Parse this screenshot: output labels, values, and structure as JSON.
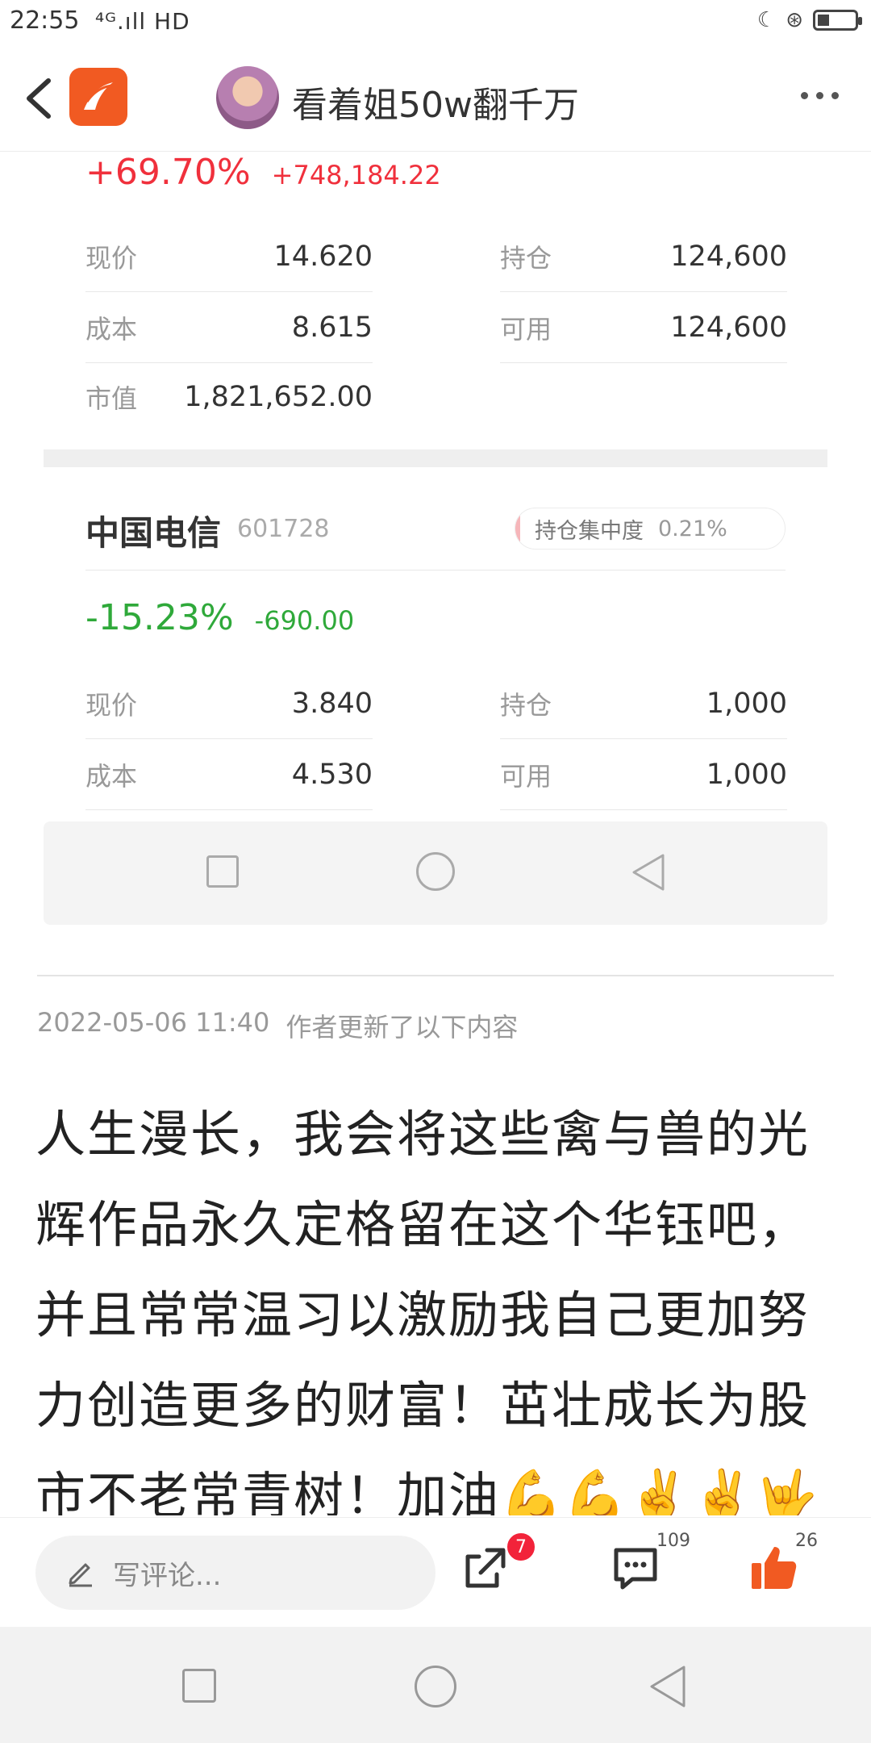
{
  "status": {
    "time": "22:55",
    "network": "⁴ᴳ.ıll HD"
  },
  "nav": {
    "title": "看着姐50w翻千万"
  },
  "stock1": {
    "pct": "+69.70%",
    "amount": "+748,184.22",
    "price_label": "现价",
    "price": "14.620",
    "holding_label": "持仓",
    "holding": "124,600",
    "cost_label": "成本",
    "cost": "8.615",
    "available_label": "可用",
    "available": "124,600",
    "mv_label": "市值",
    "mv": "1,821,652.00"
  },
  "stock2": {
    "name": "中国电信",
    "code": "601728",
    "concentration_label": "持仓集中度",
    "concentration": "0.21%",
    "pct": "-15.23%",
    "amount": "-690.00",
    "price_label": "现价",
    "price": "3.840",
    "holding_label": "持仓",
    "holding": "1,000",
    "cost_label": "成本",
    "cost": "4.530",
    "available_label": "可用",
    "available": "1,000"
  },
  "update": {
    "timestamp": "2022-05-06 11:40",
    "note": "作者更新了以下内容"
  },
  "post": {
    "text": "人生漫长，我会将这些禽与兽的光辉作品永久定格留在这个华钰吧，并且常常温习以激励我自己更加努力创造更多的财富！茁壮成长为股市不老常青树！加油💪💪✌️✌️🤟"
  },
  "bottom": {
    "comment_placeholder": "写评论...",
    "share_badge": "7",
    "comment_count": "109",
    "like_count": "26"
  },
  "colors": {
    "up": "#f0303c",
    "down": "#2fa93a",
    "brand": "#f15a22"
  },
  "icons": [
    "back-arrow-icon",
    "app-logo-icon",
    "more-dots-icon",
    "pencil-icon",
    "share-icon",
    "comment-icon",
    "thumbs-up-icon"
  ]
}
